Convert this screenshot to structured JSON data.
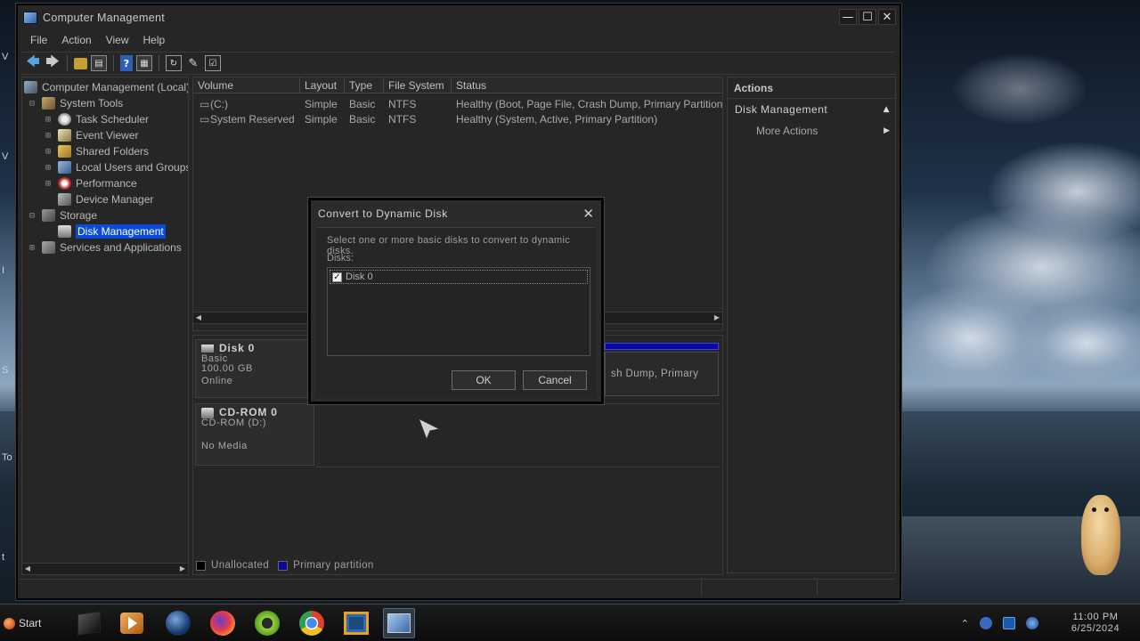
{
  "window": {
    "title": "Computer Management",
    "controls": {
      "minimize": "—",
      "maximize": "☐",
      "close": "✕"
    }
  },
  "menu": [
    "File",
    "Action",
    "View",
    "Help"
  ],
  "toolbar": {
    "icons": [
      "back-arrow-icon",
      "forward-arrow-icon",
      "folder-up-icon",
      "show-hide-tree-icon",
      "help-icon",
      "properties-icon",
      "refresh-icon",
      "export-list-icon",
      "wizard-icon"
    ]
  },
  "tree": {
    "root": "Computer Management (Local)",
    "system_tools": "System Tools",
    "task_scheduler": "Task Scheduler",
    "event_viewer": "Event Viewer",
    "shared_folders": "Shared Folders",
    "local_users": "Local Users and Groups",
    "performance": "Performance",
    "device_manager": "Device Manager",
    "storage": "Storage",
    "disk_management": "Disk Management",
    "services": "Services and Applications"
  },
  "volumes": {
    "columns": [
      "Volume",
      "Layout",
      "Type",
      "File System",
      "Status"
    ],
    "rows": [
      {
        "volume": "(C:)",
        "layout": "Simple",
        "type": "Basic",
        "fs": "NTFS",
        "status": "Healthy (Boot, Page File, Crash Dump, Primary Partition)"
      },
      {
        "volume": "System Reserved",
        "layout": "Simple",
        "type": "Basic",
        "fs": "NTFS",
        "status": "Healthy (System, Active, Primary Partition)"
      }
    ]
  },
  "diskmap": {
    "disk0": {
      "name": "Disk 0",
      "type": "Basic",
      "size": "100.00 GB",
      "state": "Online",
      "partition_text": "sh Dump, Primary"
    },
    "cdrom0": {
      "name": "CD-ROM 0",
      "type": "CD-ROM (D:)",
      "state": "No Media"
    }
  },
  "legend": {
    "unallocated": "Unallocated",
    "primary": "Primary partition",
    "unallocated_color": "#000000",
    "primary_color": "#0a0a9a"
  },
  "actions": {
    "header": "Actions",
    "section": "Disk Management",
    "more": "More Actions"
  },
  "dialog": {
    "title": "Convert to Dynamic Disk",
    "close": "✕",
    "description": "Select one or more basic disks to convert to dynamic disks.",
    "disks_label": "Disks:",
    "disks": [
      {
        "label": "Disk 0",
        "checked": true
      }
    ],
    "ok": "OK",
    "cancel": "Cancel"
  },
  "taskbar": {
    "start": "Start",
    "apps": [
      "cube-app-icon",
      "media-player-icon",
      "globe-icon",
      "firefox-icon",
      "cleaner-icon",
      "chrome-icon",
      "virtualbox-icon",
      "computer-management-icon"
    ],
    "clock": {
      "time": "11:00 PM",
      "date": "6/25/2024"
    }
  },
  "desktop": {
    "edge_glyphs": [
      "V",
      "V",
      "I",
      "S",
      "To",
      "t"
    ]
  }
}
